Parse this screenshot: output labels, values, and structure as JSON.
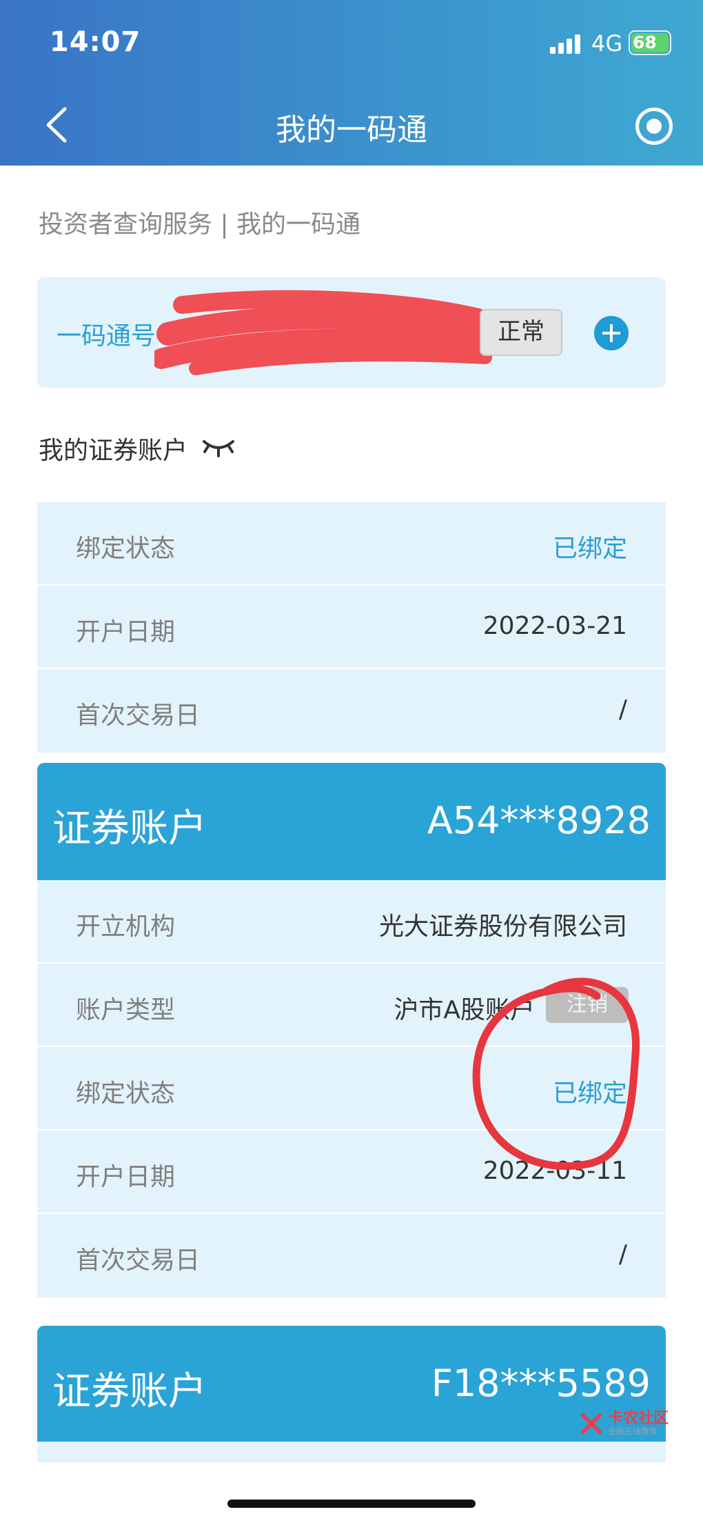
{
  "status_bar": {
    "time": "14:07",
    "network": "4G",
    "battery": "68"
  },
  "nav": {
    "title": "我的一码通"
  },
  "breadcrumb": "投资者查询服务 | 我的一码通",
  "ymt": {
    "label": "一码通号",
    "status": "正常"
  },
  "section_title": "我的证券账户",
  "account_partial": {
    "rows": [
      {
        "label": "绑定状态",
        "value": "已绑定"
      },
      {
        "label": "开户日期",
        "value": "2022-03-21"
      },
      {
        "label": "首次交易日",
        "value": "/"
      }
    ]
  },
  "account_a": {
    "title": "证券账户",
    "number": "A54***8928",
    "rows": [
      {
        "label": "开立机构",
        "value": "光大证券股份有限公司"
      },
      {
        "label": "账户类型",
        "value": "沪市A股账户",
        "badge": "注销"
      },
      {
        "label": "绑定状态",
        "value": "已绑定"
      },
      {
        "label": "开户日期",
        "value": "2022-03-11"
      },
      {
        "label": "首次交易日",
        "value": "/"
      }
    ]
  },
  "account_f": {
    "title": "证券账户",
    "number": "F18***5589"
  },
  "watermark": {
    "title": "卡农社区",
    "subtitle": "金融在线教育"
  },
  "colors": {
    "header_blue": "#3b8fcc",
    "accent_blue": "#2aa3d7",
    "row_bg": "#e3f3fb",
    "annotation_red": "#e8363f"
  }
}
